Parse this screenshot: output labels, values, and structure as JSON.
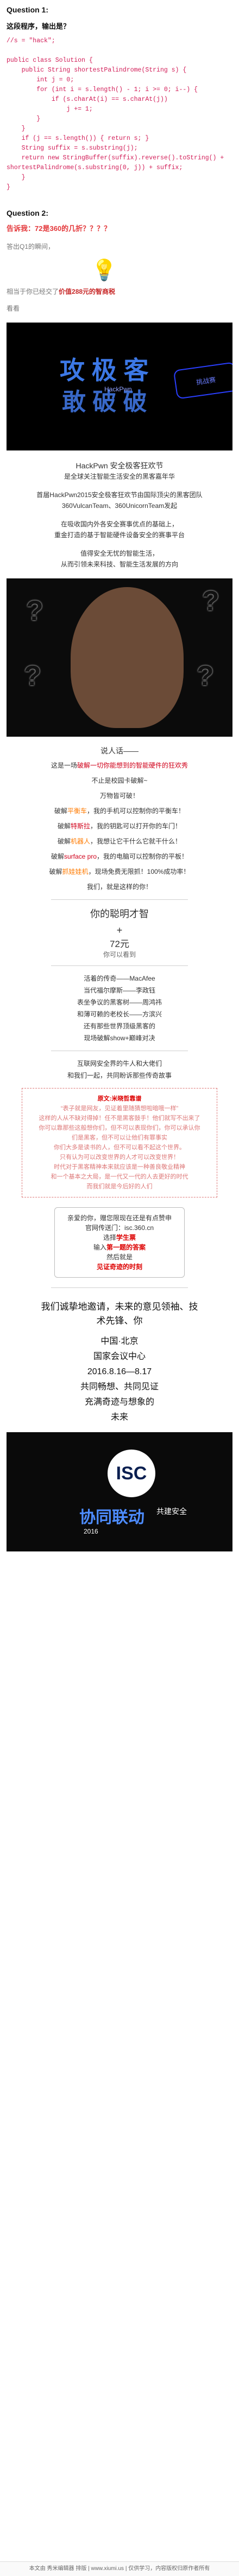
{
  "question1": {
    "title": "Question 1:",
    "instruction": "这段程序，输出是？",
    "code_lines": [
      "//s = \"hack\";",
      "",
      "public class Solution {",
      "    public String shortestPalindrome(String s) {",
      "        int j = 0;",
      "        for (int i = s.length() - 1; i >= 0; i--) {",
      "            if (s.charAt(i) == s.charAt(j))",
      "                j += 1;",
      "        }",
      "    }",
      "    if (j == s.length()) { return s; }",
      "    String suffix = s.substring(j);",
      "    return new StringBuffer(suffix).reverse().toString() +",
      "shortestPalindrome(s.substring(0, j)) + suffix;",
      "    }",
      "}"
    ]
  },
  "question2": {
    "title": "Question 2:",
    "line1": "告诉我：72是360的几折？？？？",
    "line2": "答出Q1的瞬间，",
    "line3_prefix": "相当于你已经交了",
    "line3_highlight": "价值288元的智商税",
    "line4": "看看"
  },
  "hero": {
    "title_part1": "攻 极 客",
    "title_part2": "敢 破 破",
    "badge": "挑战赛",
    "tag": "HackPwn"
  },
  "intro": {
    "head": "HackPwn 安全极客狂欢节",
    "sub": "是全球关注智能生活安全的黑客嘉年华",
    "p1": "首届HackPwn2015安全极客狂欢节由国际顶尖的黑客团队",
    "p1b": "360VulcanTeam、360UnicornTeam发起",
    "p2": "在吸收国内外各安全赛事优点的基础上，",
    "p2b": "重金打造的基于智能硬件设备安全的赛事平台",
    "p3": "值得安全无忧的智能生活，",
    "p3b": "从而引领未来科技、智能生活发展的方向"
  },
  "photo": {
    "q": "?"
  },
  "challenge": {
    "title": "说人话——",
    "line1_prefix": "这是一场",
    "line1_highlight": "破解一切你能想到的智能硬件的狂欢秀",
    "line2": "不止是校园卡破解~",
    "line3": "万物皆可破！",
    "items": [
      {
        "prefix": "破解",
        "highlight": "平衡车",
        "suffix": "，我的手机可以控制你的平衡车！"
      },
      {
        "prefix": "破解",
        "highlight": "特斯拉",
        "suffix": "，我的钥匙可以打开你的车门！"
      },
      {
        "prefix": "破解",
        "highlight": "机器人",
        "suffix": "，我想让它干什么它就干什么！"
      },
      {
        "prefix": "破解",
        "highlight": "surface pro",
        "suffix": "，我的电脑可以控制你的平板！"
      },
      {
        "prefix": "破解",
        "highlight": "抓娃娃机",
        "suffix": "，现场免费无限抓！100%成功率！"
      }
    ],
    "closing": "我们，就是这样的你！"
  },
  "promo": {
    "line1": "你的聪明才智",
    "line2": "+",
    "line3": "72元",
    "line4": "你可以看到"
  },
  "guests": {
    "lines": [
      "活着的传奇——MacAfee",
      "当代福尔摩斯——李政钰",
      "表坐争议的黑客树——周鸿祎",
      "和薄可赖的老校长——方滨兴",
      "还有那些世界顶级黑客的",
      "现场破解show+巅峰对决"
    ],
    "closing1": "互联网安全界的牛人和大佬们",
    "closing2": "和我们一起，共同盼诉那些传奇故事"
  },
  "quote_box": {
    "title": "原文:米晓哲靠谱",
    "l1": "“表子就是网友，见证着里随猜想啦暗哦一样”",
    "l2": "这样的人从不缺对得掉！任不是黑客鼓手！他们就写不出来了",
    "l3": "你可以靠那些这般想你们，但不可以表现你们，你可以承认你",
    "l4": "们是黑客，但不可以让他们有罪事实",
    "l5": "你们大多是读书的人，但不可以看不起这个世界。",
    "l6": "只有认为可以改变世界的人才可以改变世界！",
    "l7": "时代对于黑客精神本来就应该是一种善良敬业精神",
    "l8": "和一个基本之大局，是一代又一代的人去更好的时代",
    "l9": "而我们就是今后好的人们"
  },
  "gift": {
    "l1": "亲爱的你，赠您限现在还是有点赞申",
    "l2": "官网传送门：isc.360.cn",
    "l3_prefix": "选择",
    "l3_highlight": "学生票",
    "l4_prefix": "输入",
    "l4_highlight": "第一题的答案",
    "l5": "然后就是",
    "l6": "见证奇迹的时刻"
  },
  "invite": {
    "l1": "我们诚挚地邀请，未来的意见领袖、技",
    "l2": "术先锋、你"
  },
  "event_info": {
    "place1": "中国·北京",
    "place2": "国家会议中心",
    "date": "2016.8.16—8.17",
    "slogan1": "共同畅想、共同见证",
    "slogan2": "充满奇迹与想象的",
    "slogan3": "未来"
  },
  "bottom_banner": {
    "logo_text": "ISC",
    "text1": "协同联动",
    "text2": "共建安全",
    "date": "2016"
  },
  "footer": {
    "text": "本文由 秀米编辑器 排版 | www.xiumi.us | 仅供学习，内容版权归原作者所有"
  }
}
